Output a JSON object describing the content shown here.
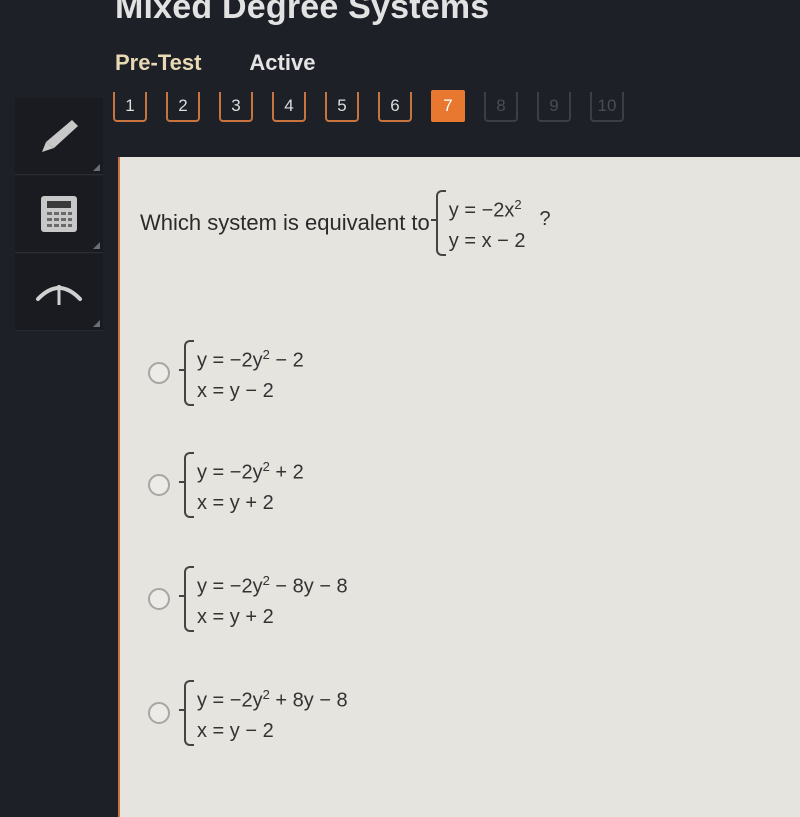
{
  "header": {
    "title": "Mixed Degree Systems",
    "subtabs": [
      "Pre-Test",
      "Active"
    ]
  },
  "question_nav": {
    "items": [
      {
        "label": "1",
        "state": "answered"
      },
      {
        "label": "2",
        "state": "answered"
      },
      {
        "label": "3",
        "state": "answered"
      },
      {
        "label": "4",
        "state": "answered"
      },
      {
        "label": "5",
        "state": "answered"
      },
      {
        "label": "6",
        "state": "answered"
      },
      {
        "label": "7",
        "state": "current"
      },
      {
        "label": "8",
        "state": "locked"
      },
      {
        "label": "9",
        "state": "locked"
      },
      {
        "label": "10",
        "state": "locked"
      }
    ],
    "accent_color": "#e8782f"
  },
  "tools": [
    {
      "name": "pencil-icon"
    },
    {
      "name": "calculator-icon"
    },
    {
      "name": "reference-icon"
    }
  ],
  "question": {
    "prompt": "Which system is equivalent to",
    "system": [
      "y = −2x",
      "y = x − 2"
    ],
    "system_sup": "2",
    "suffix": "?"
  },
  "options": [
    {
      "eq1_a": "y = −2y",
      "eq1_b": " − 2",
      "eq2": "x = y − 2",
      "selected": false
    },
    {
      "eq1_a": "y = −2y",
      "eq1_b": " + 2",
      "eq2": "x = y + 2",
      "selected": false
    },
    {
      "eq1_a": "y = −2y",
      "eq1_b": " − 8y − 8",
      "eq2": "x = y + 2",
      "selected": false
    },
    {
      "eq1_a": "y = −2y",
      "eq1_b": " + 8y − 8",
      "eq2": "x = y − 2",
      "selected": false
    }
  ],
  "sup2": "2"
}
